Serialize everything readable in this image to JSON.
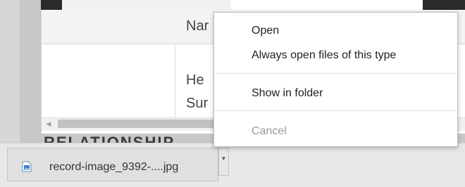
{
  "table": {
    "column_header": "Nar",
    "rows": [
      "He",
      "Sur"
    ]
  },
  "section": {
    "heading": "RELATIONSHIP"
  },
  "download": {
    "filename": "record-image_9392-....jpg",
    "file_icon": "image-file-icon",
    "chevron_icon": "chevron-down-icon"
  },
  "context_menu": {
    "items": [
      {
        "label": "Open",
        "enabled": true
      },
      {
        "label": "Always open files of this type",
        "enabled": true
      },
      {
        "label": "Show in folder",
        "enabled": true
      },
      {
        "label": "Cancel",
        "enabled": false
      }
    ]
  },
  "colors": {
    "menu_background": "#ffffff",
    "disabled_text": "#9a9a9a",
    "download_bar": "#e8e8e8"
  }
}
